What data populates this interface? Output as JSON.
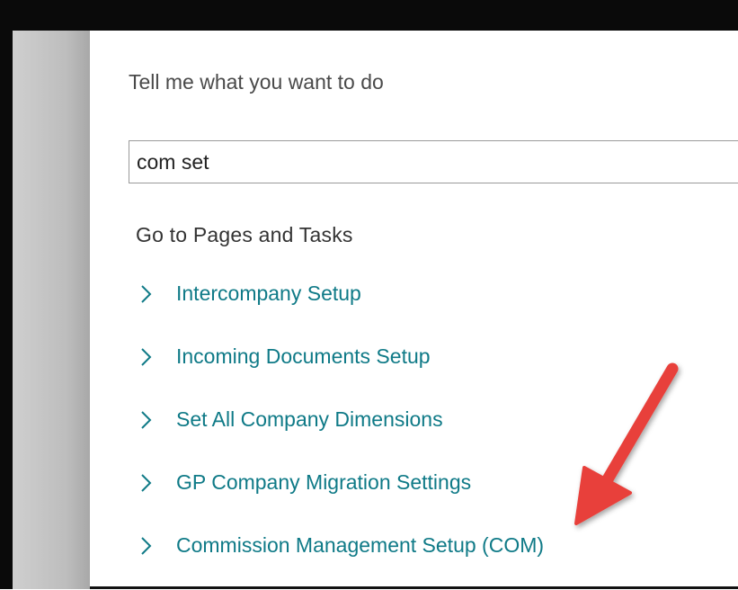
{
  "prompt": "Tell me what you want to do",
  "search": {
    "value": "com set"
  },
  "section_heading": "Go to Pages and Tasks",
  "results": [
    {
      "label": "Intercompany Setup"
    },
    {
      "label": "Incoming Documents Setup"
    },
    {
      "label": "Set All Company Dimensions"
    },
    {
      "label": "GP Company Migration Settings"
    },
    {
      "label": "Commission Management Setup (COM)"
    }
  ],
  "icons": {
    "result_chevron": "chevron-right-icon",
    "annotation": "red-arrow-icon"
  },
  "colors": {
    "link": "#0f7a87",
    "annotation_arrow": "#e8413b",
    "text": "#4a4a4a"
  }
}
